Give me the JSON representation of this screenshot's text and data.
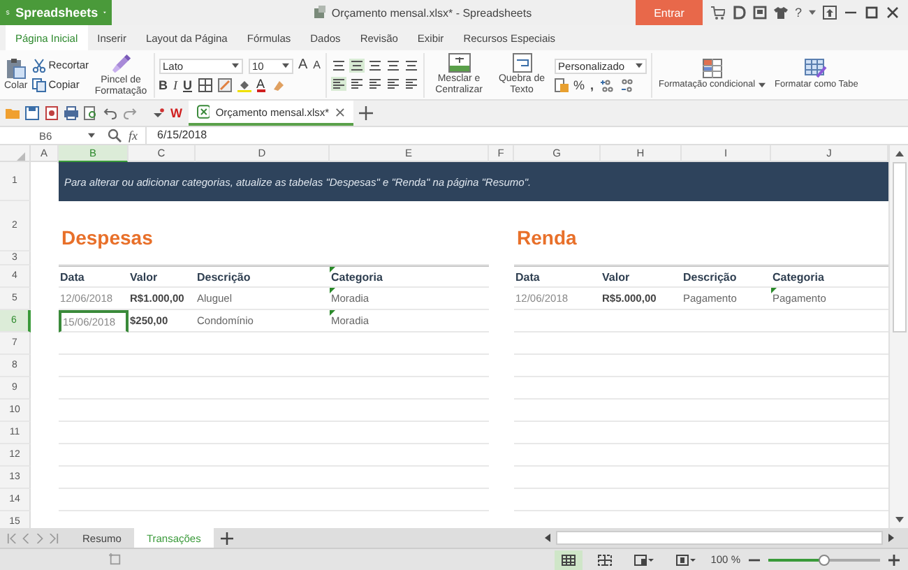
{
  "title_bar": {
    "app_name": "Spreadsheets",
    "document_title": "Orçamento mensal.xlsx* - Spreadsheets",
    "sign_in": "Entrar",
    "help": "?"
  },
  "menu_tabs": [
    {
      "label": "Página Inicial",
      "selected": true
    },
    {
      "label": "Inserir",
      "selected": false
    },
    {
      "label": "Layout da Página",
      "selected": false
    },
    {
      "label": "Fórmulas",
      "selected": false
    },
    {
      "label": "Dados",
      "selected": false
    },
    {
      "label": "Revisão",
      "selected": false
    },
    {
      "label": "Exibir",
      "selected": false
    },
    {
      "label": "Recursos Especiais",
      "selected": false
    }
  ],
  "ribbon": {
    "paste": "Colar",
    "cut": "Recortar",
    "copy": "Copiar",
    "format_painter": "Pincel de Formatação",
    "font": "Lato",
    "font_size": "10",
    "grow_font": "A",
    "shrink_font": "A",
    "bold": "B",
    "italic": "I",
    "underline": "U",
    "font_color": "A",
    "merge": "Mesclar e Centralizar",
    "wrap": "Quebra de Texto",
    "number_format": "Personalizado",
    "percent": "%",
    "comma": ",",
    "conditional": "Formatação condicional",
    "format_table": "Formatar como Tabe"
  },
  "quick_toolbar": {
    "wps_mark": "W",
    "document_tab": "Orçamento mensal.xlsx*"
  },
  "formula_bar": {
    "name_box": "B6",
    "fx": "fx",
    "value": "6/15/2018"
  },
  "sheet": {
    "columns": [
      {
        "label": "A",
        "selected": false
      },
      {
        "label": "B",
        "selected": true
      },
      {
        "label": "C",
        "selected": false
      },
      {
        "label": "D",
        "selected": false
      },
      {
        "label": "E",
        "selected": false
      },
      {
        "label": "F",
        "selected": false
      },
      {
        "label": "G",
        "selected": false
      },
      {
        "label": "H",
        "selected": false
      },
      {
        "label": "I",
        "selected": false
      },
      {
        "label": "J",
        "selected": false
      }
    ],
    "rows": [
      {
        "number": "1",
        "selected": false
      },
      {
        "number": "2",
        "selected": false
      },
      {
        "number": "3",
        "selected": false
      },
      {
        "number": "4",
        "selected": false
      },
      {
        "number": "5",
        "selected": false
      },
      {
        "number": "6",
        "selected": true
      },
      {
        "number": "7",
        "selected": false
      },
      {
        "number": "8",
        "selected": false
      },
      {
        "number": "9",
        "selected": false
      },
      {
        "number": "10",
        "selected": false
      },
      {
        "number": "11",
        "selected": false
      },
      {
        "number": "12",
        "selected": false
      },
      {
        "number": "13",
        "selected": false
      },
      {
        "number": "14",
        "selected": false
      },
      {
        "number": "15",
        "selected": false
      }
    ],
    "banner": "Para alterar ou adicionar categorias, atualize as tabelas \"Despesas\" e \"Renda\" na página \"Resumo\".",
    "tables": [
      {
        "title": "Despesas",
        "headers": [
          "Data",
          "Valor",
          "Descrição",
          "Categoria"
        ],
        "header_flagged": true,
        "rows": [
          {
            "cells": [
              "12/06/2018",
              "R$1.000,00",
              "Aluguel",
              "Moradia"
            ],
            "flagged": true
          },
          {
            "cells": [
              "15/06/2018",
              "$250,00",
              "Condomínio",
              "Moradia"
            ],
            "flagged": true
          }
        ]
      },
      {
        "title": "Renda",
        "headers": [
          "Data",
          "Valor",
          "Descrição",
          "Categoria"
        ],
        "header_flagged": false,
        "rows": [
          {
            "cells": [
              "12/06/2018",
              "R$5.000,00",
              "Pagamento",
              "Pagamento"
            ],
            "flagged": true
          }
        ]
      }
    ]
  },
  "sheet_tabs": [
    {
      "label": "Resumo",
      "selected": false
    },
    {
      "label": "Transações",
      "selected": true
    }
  ],
  "status_bar": {
    "zoom": "100 %",
    "zoom_slider": {
      "level": 0.5
    }
  }
}
